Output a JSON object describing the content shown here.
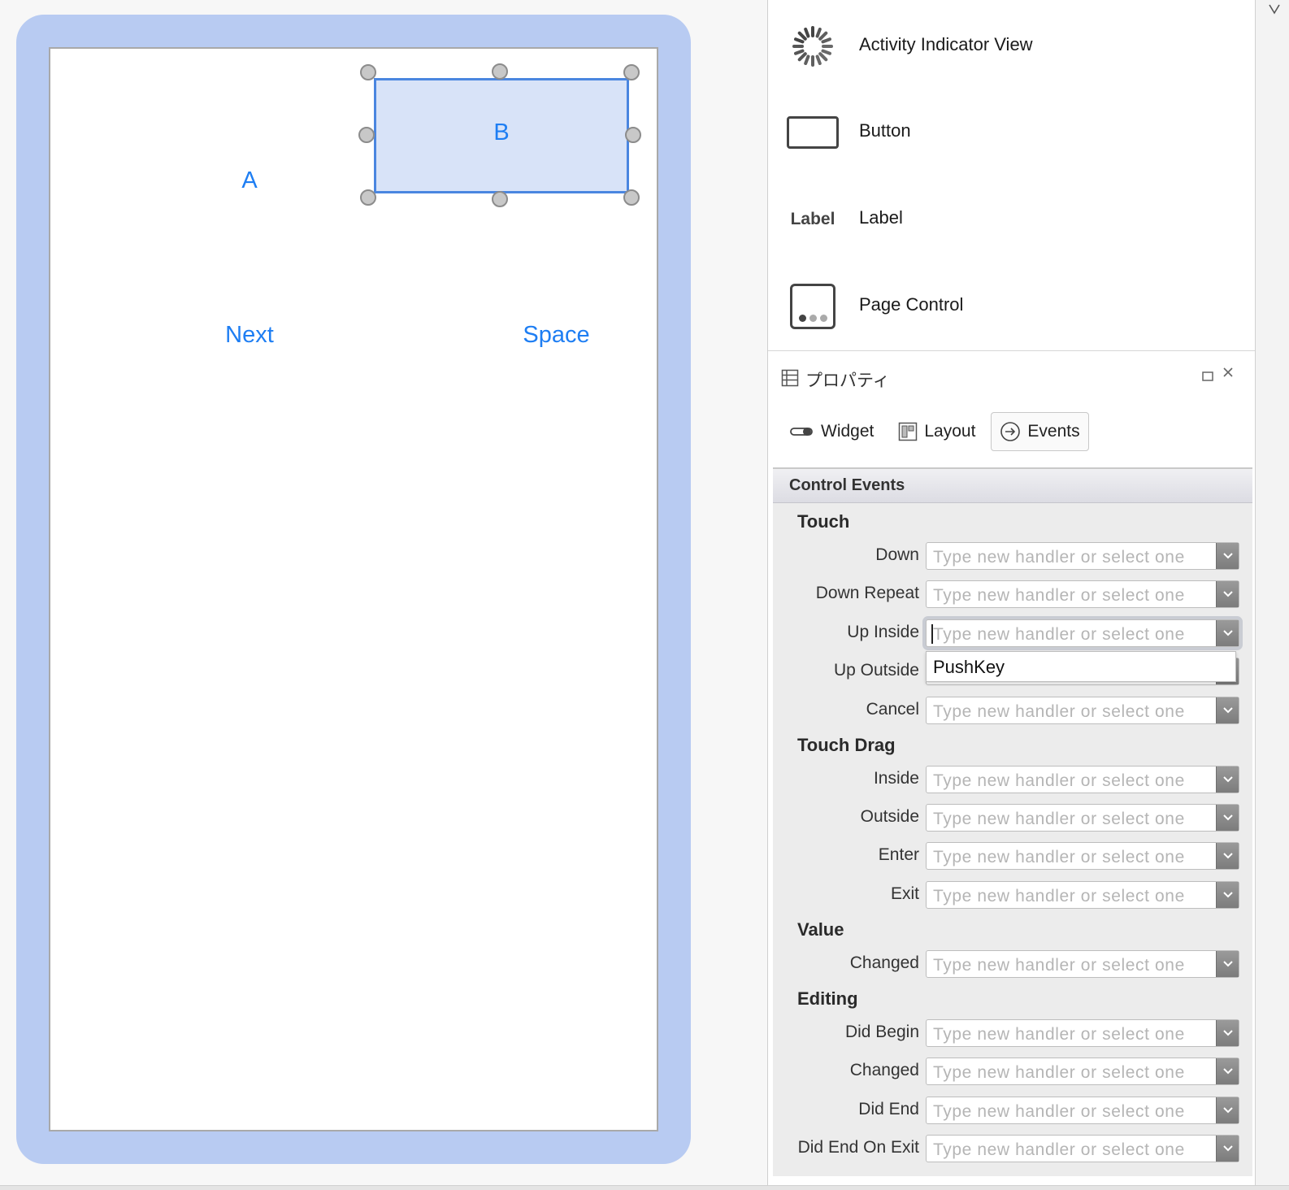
{
  "canvas": {
    "buttons": {
      "a": "A",
      "b": "B",
      "next": "Next",
      "space": "Space"
    }
  },
  "toolbox": {
    "items": [
      {
        "label": "Activity Indicator View",
        "icon": "activity-indicator-icon"
      },
      {
        "label": "Button",
        "icon": "button-icon"
      },
      {
        "label": "Label",
        "icon": "label-icon",
        "icon_text": "Label"
      },
      {
        "label": "Page Control",
        "icon": "page-control-icon"
      }
    ]
  },
  "properties": {
    "title": "プロパティ",
    "tabs": [
      {
        "label": "Widget",
        "icon": "widget-toggle-icon"
      },
      {
        "label": "Layout",
        "icon": "layout-grid-icon"
      },
      {
        "label": "Events",
        "icon": "arrow-circle-icon",
        "active": true
      }
    ],
    "section": "Control Events",
    "placeholder": "Type new handler or select one",
    "groups": {
      "touch": "Touch",
      "touch_drag": "Touch Drag",
      "value": "Value",
      "editing": "Editing"
    },
    "rows": {
      "down": "Down",
      "down_repeat": "Down Repeat",
      "up_inside": "Up Inside",
      "up_outside": "Up Outside",
      "cancel": "Cancel",
      "drag_inside": "Inside",
      "drag_outside": "Outside",
      "drag_enter": "Enter",
      "drag_exit": "Exit",
      "value_changed": "Changed",
      "did_begin": "Did Begin",
      "editing_changed": "Changed",
      "did_end": "Did End",
      "did_end_on_exit": "Did End On Exit"
    },
    "dropdown_options": [
      "PushKey"
    ]
  },
  "colors": {
    "device_frame": "#b8cbf2",
    "selection": "#4a86e0",
    "button_text": "#1e7ef3"
  }
}
